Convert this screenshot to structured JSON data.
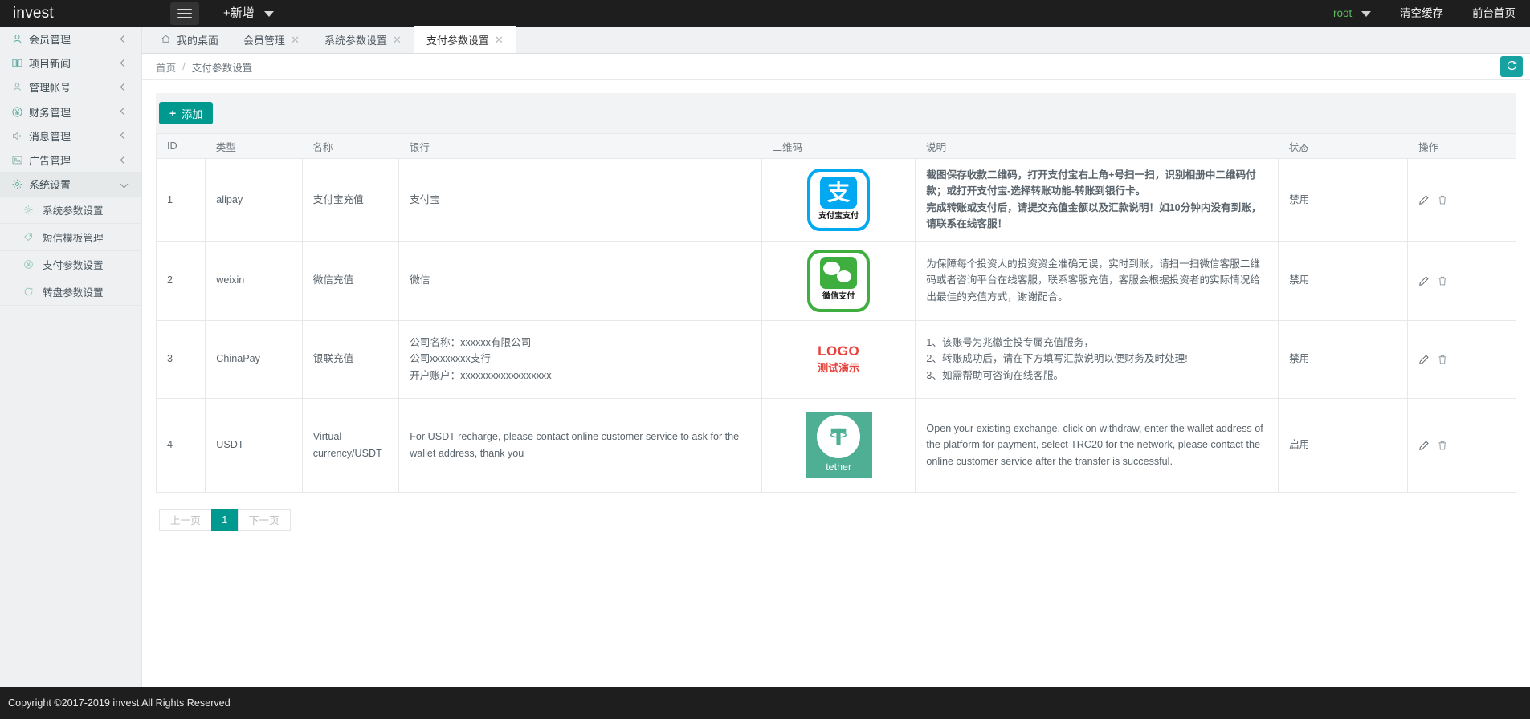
{
  "topbar": {
    "brand": "invest",
    "menu_icon": "hamburger-icon",
    "add_new": "+新增",
    "user": "root",
    "clear_cache": "清空缓存",
    "front_home": "前台首页"
  },
  "sidebar": {
    "items": [
      {
        "label": "会员管理",
        "icon": "user-icon",
        "arrow": "left"
      },
      {
        "label": "项目新闻",
        "icon": "book-icon",
        "arrow": "left"
      },
      {
        "label": "管理帐号",
        "icon": "user-circle-icon",
        "arrow": "left"
      },
      {
        "label": "财务管理",
        "icon": "yen-circle-icon",
        "arrow": "left"
      },
      {
        "label": "消息管理",
        "icon": "speaker-icon",
        "arrow": "left"
      },
      {
        "label": "广告管理",
        "icon": "image-icon",
        "arrow": "left"
      },
      {
        "label": "系统设置",
        "icon": "gear-icon",
        "arrow": "down"
      }
    ],
    "subitems": [
      {
        "label": "系统参数设置",
        "icon": "gear-icon"
      },
      {
        "label": "短信模板管理",
        "icon": "tag-icon"
      },
      {
        "label": "支付参数设置",
        "icon": "yen-circle-icon"
      },
      {
        "label": "转盘参数设置",
        "icon": "refresh-circle-icon"
      }
    ]
  },
  "tabs": [
    {
      "label": "我的桌面",
      "icon": "home-icon",
      "closable": false,
      "active": false
    },
    {
      "label": "会员管理",
      "closable": true,
      "active": false
    },
    {
      "label": "系统参数设置",
      "closable": true,
      "active": false
    },
    {
      "label": "支付参数设置",
      "closable": true,
      "active": true
    }
  ],
  "breadcrumb": {
    "home": "首页",
    "separator": "/",
    "current": "支付参数设置",
    "refresh_icon": "refresh-icon"
  },
  "toolbar": {
    "add_label": "添加",
    "add_icon": "plus-icon"
  },
  "table": {
    "headers": [
      "ID",
      "类型",
      "名称",
      "银行",
      "二维码",
      "说明",
      "状态",
      "操作"
    ],
    "rows": [
      {
        "id": "1",
        "type": "alipay",
        "name": "支付宝充值",
        "bank": "支付宝",
        "qr": {
          "kind": "alipay-logo",
          "caption": "支付宝支付",
          "glyph": "支"
        },
        "desc": "截图保存收款二维码，打开支付宝右上角+号扫一扫，识别相册中二维码付款；或打开支付宝-选择转账功能-转账到银行卡。\n完成转账或支付后，请提交充值金额以及汇款说明！如10分钟内没有到账，请联系在线客服！",
        "desc_style": "red",
        "state": "禁用",
        "actions": [
          "edit-icon",
          "delete-icon"
        ]
      },
      {
        "id": "2",
        "type": "weixin",
        "name": "微信充值",
        "bank": "微信",
        "qr": {
          "kind": "wechat-logo",
          "caption": "微信支付"
        },
        "desc": "为保障每个投资人的投资资金准确无误，实时到账，请扫一扫微信客服二维码或者咨询平台在线客服，联系客服充值，客服会根据投资者的实际情况给出最佳的充值方式，谢谢配合。",
        "desc_style": "normal",
        "state": "禁用",
        "actions": [
          "edit-icon",
          "delete-icon"
        ]
      },
      {
        "id": "3",
        "type": "ChinaPay",
        "name": "银联充值",
        "bank": "公司名称：xxxxxx有限公司\n公司xxxxxxxx支行\n开户账户：xxxxxxxxxxxxxxxxxx",
        "qr": {
          "kind": "text-logo",
          "line1": "LOGO",
          "line2": "测试演示"
        },
        "desc": "1、该账号为兆徽金投专属充值服务，\n2、转账成功后，请在下方填写汇款说明以便财务及时处理!\n3、如需帮助可咨询在线客服。",
        "desc_style": "normal",
        "state": "禁用",
        "actions": [
          "edit-icon",
          "delete-icon"
        ]
      },
      {
        "id": "4",
        "type": "USDT",
        "name": "Virtual currency/USDT",
        "bank": "For USDT recharge, please contact online customer service to ask for the wallet address, thank you",
        "qr": {
          "kind": "tether-logo",
          "caption": "tether"
        },
        "desc": "Open your existing exchange, click on withdraw, enter the wallet address of the platform for payment, select TRC20 for the network, please contact the online customer service after the transfer is successful.",
        "desc_style": "normal",
        "state": "启用",
        "actions": [
          "edit-icon",
          "delete-icon"
        ]
      }
    ]
  },
  "pagination": {
    "prev": "上一页",
    "pages": [
      "1"
    ],
    "current": "1",
    "next": "下一页"
  },
  "footer": {
    "text": "Copyright ©2017-2019 invest All Rights Reserved"
  },
  "colors": {
    "accent": "#00998f",
    "topbar": "#1e1e1e",
    "sidebar": "#eef0f1",
    "danger": "#f23a30",
    "alipay": "#02A9F1",
    "wechat": "#3EAF3F",
    "tether": "#4FAF95",
    "user": "#5cb85c"
  }
}
